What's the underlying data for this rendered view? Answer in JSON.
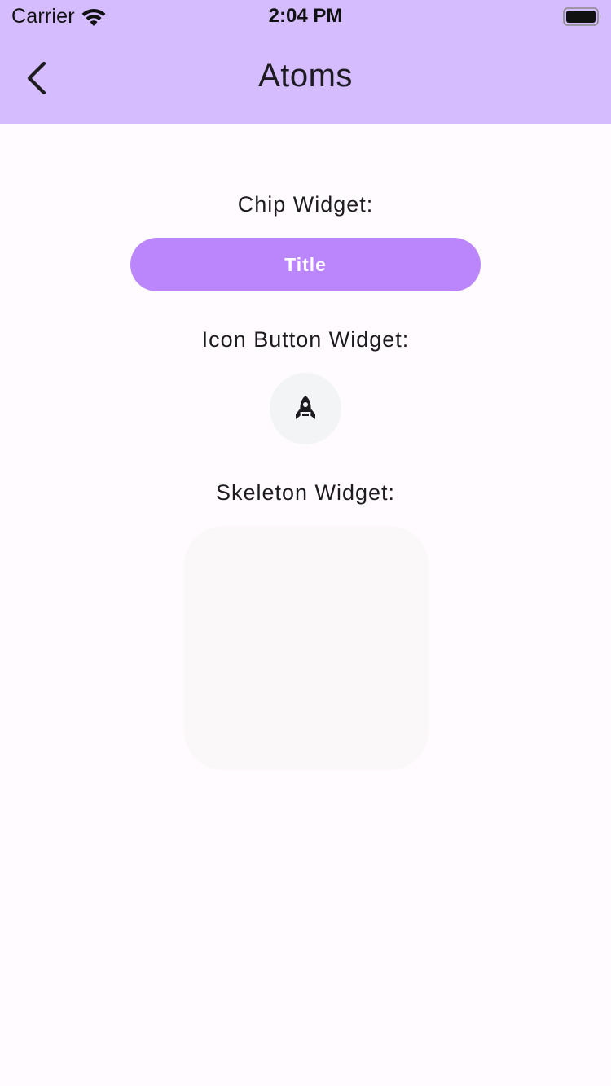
{
  "status_bar": {
    "carrier": "Carrier",
    "time": "2:04 PM"
  },
  "app_bar": {
    "title": "Atoms",
    "back_icon": "chevron-left-icon"
  },
  "sections": {
    "chip_label": "Chip Widget:",
    "chip_text": "Title",
    "icon_button_label": "Icon Button Widget:",
    "icon_button_icon": "rocket-icon",
    "skeleton_label": "Skeleton Widget:"
  },
  "colors": {
    "app_bar_bg": "#d4bcff",
    "page_bg": "#fffbff",
    "chip_bg": "#bb86fc",
    "icon_button_bg": "#f2f4f6",
    "skeleton_bg": "#fbf8fa"
  }
}
